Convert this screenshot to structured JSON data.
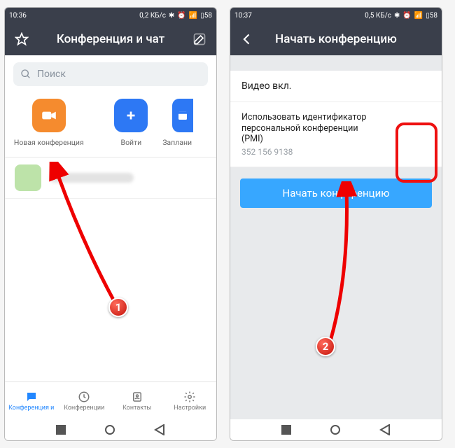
{
  "left": {
    "statusbar": {
      "time": "10:36",
      "net": "0,2 КБ/с",
      "batt": "58"
    },
    "header": {
      "title": "Конференция и чат"
    },
    "search": {
      "placeholder": "Поиск"
    },
    "actions": {
      "new_conf": "Новая конференция",
      "enter": "Войти",
      "scheduled": "Заплани"
    },
    "bottomnav": {
      "conf_chat": "Конференция и",
      "conferences": "Конференции",
      "contacts": "Контакты",
      "settings": "Настройки"
    },
    "badge": "1"
  },
  "right": {
    "statusbar": {
      "time": "10:37",
      "net": "0,5 КБ/с",
      "batt": "58"
    },
    "header": {
      "title": "Начать конференцию"
    },
    "video_label": "Видео вкл.",
    "pmi_label": "Использовать идентификатор персональной конференции (PMI)",
    "pmi_value": "352 156 9138",
    "start_btn": "Начать конференцию",
    "badge": "2"
  }
}
